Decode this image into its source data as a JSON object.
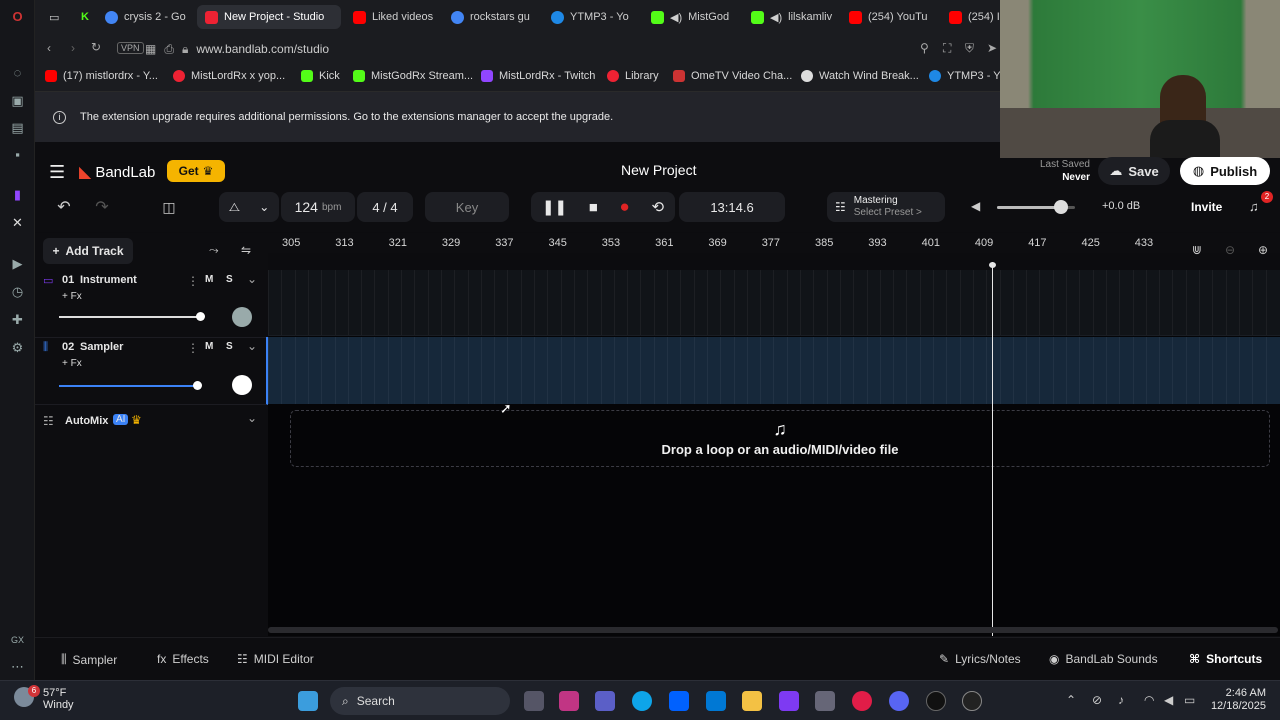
{
  "browser": {
    "tabs": [
      {
        "label": "crysis 2 - Go",
        "color": "#4285f4"
      },
      {
        "label": "New Project - Studio",
        "color": "#e23",
        "active": true
      },
      {
        "label": "Liked videos",
        "color": "#f00"
      },
      {
        "label": "rockstars gu",
        "color": "#4285f4"
      },
      {
        "label": "YTMP3 - Yo",
        "color": "#1e88e5"
      },
      {
        "label": "MistGod",
        "color": "#53fc18"
      },
      {
        "label": "lilskamliv",
        "color": "#53fc18"
      },
      {
        "label": "(254) YouTu",
        "color": "#f00"
      },
      {
        "label": "(254) Is",
        "color": "#f00"
      }
    ],
    "url": "www.bandlab.com/studio",
    "vpn_label": "VPN",
    "bookmarks": [
      {
        "label": "(17) mistlordrx - Y...",
        "color": "#f00"
      },
      {
        "label": "MistLordRx x yop...",
        "color": "#e23"
      },
      {
        "label": "Kick",
        "color": "#53fc18"
      },
      {
        "label": "MistGodRx Stream...",
        "color": "#53fc18"
      },
      {
        "label": "MistLordRx - Twitch",
        "color": "#9146ff"
      },
      {
        "label": "Library",
        "color": "#e23"
      },
      {
        "label": "OmeTV Video Cha...",
        "color": "#c33"
      },
      {
        "label": "Watch Wind Break...",
        "color": "#ddd"
      },
      {
        "label": "YTMP3 - Yo",
        "color": "#1e88e5"
      }
    ],
    "notice": "The extension upgrade requires additional permissions. Go to the extensions manager to accept the upgrade."
  },
  "app": {
    "brand": "BandLab",
    "get_label": "Get",
    "project_title": "New Project",
    "last_saved_label": "Last Saved",
    "last_saved_value": "Never",
    "save_label": "Save",
    "publish_label": "Publish",
    "bpm_value": "124",
    "bpm_unit": "bpm",
    "time_sig": "4 / 4",
    "key_label": "Key",
    "time_display": "13:14.6",
    "mastering_label": "Mastering",
    "mastering_preset": "Select Preset >",
    "volume_db": "+0.0 dB",
    "master_volume_level": 0.82,
    "invite_label": "Invite",
    "notification_count": "2",
    "add_track_label": "Add Track",
    "ruler_labels": [
      "305",
      "313",
      "321",
      "329",
      "337",
      "345",
      "353",
      "361",
      "369",
      "377",
      "385",
      "393",
      "401",
      "409",
      "417",
      "425",
      "433"
    ],
    "tracks": [
      {
        "number": "01",
        "name": "Instrument",
        "fx": "+ Fx",
        "mute": "M",
        "solo": "S",
        "color": "#7c3aed",
        "volume": 1.0
      },
      {
        "number": "02",
        "name": "Sampler",
        "fx": "+ Fx",
        "mute": "M",
        "solo": "S",
        "color": "#3b82f6",
        "volume": 0.98
      }
    ],
    "automix_label": "AutoMix",
    "ai_badge": "AI",
    "drop_label": "Drop a loop or an audio/MIDI/video file",
    "bottom": {
      "sampler": "Sampler",
      "effects": "Effects",
      "midi_editor": "MIDI Editor",
      "lyrics": "Lyrics/Notes",
      "sounds": "BandLab Sounds",
      "shortcuts": "Shortcuts"
    }
  },
  "taskbar": {
    "weather_temp": "57°F",
    "weather_desc": "Windy",
    "weather_badge": "6",
    "search_label": "Search",
    "time": "2:46 AM",
    "date": "12/18/2025"
  }
}
